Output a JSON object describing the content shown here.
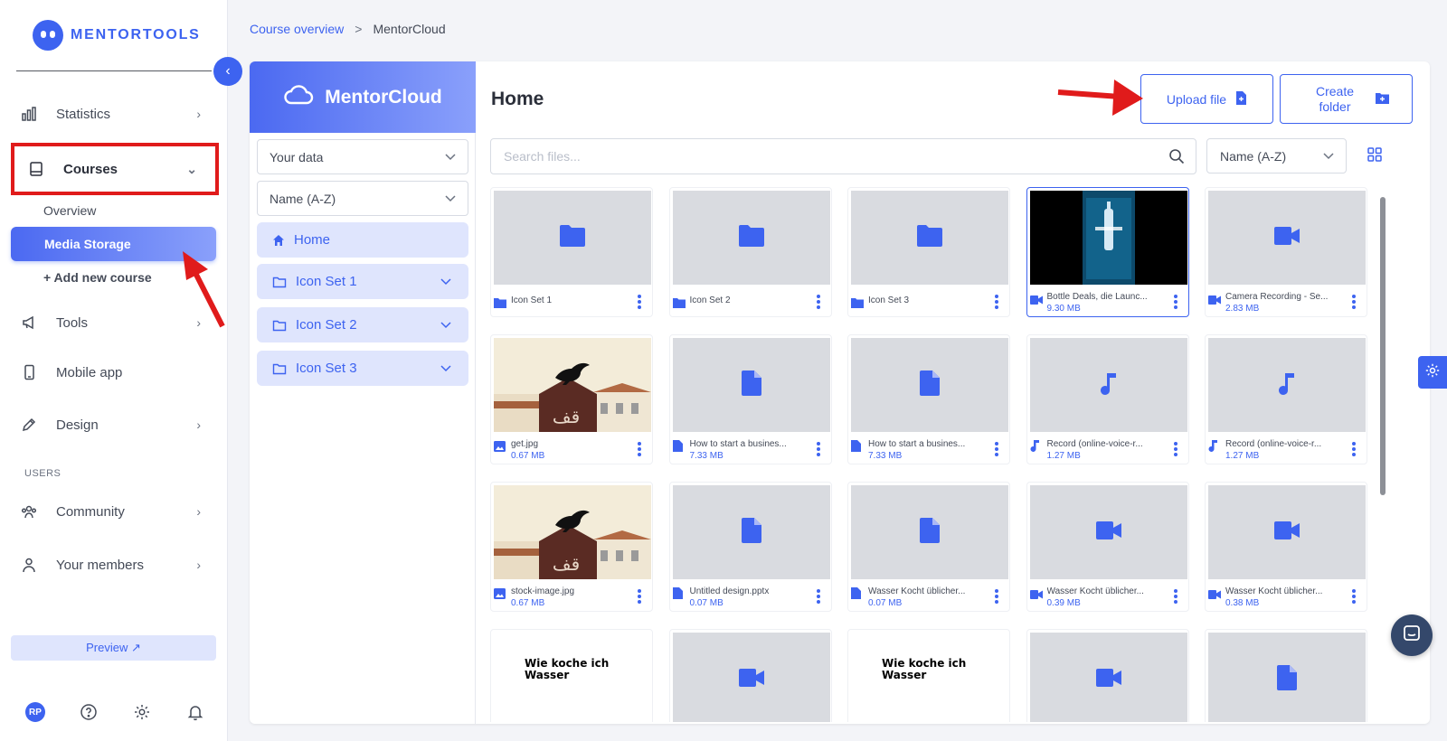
{
  "brand": {
    "name": "MENTORTOOLS"
  },
  "sidebar": {
    "items": [
      {
        "label": "Statistics",
        "icon": "bar-chart-icon"
      },
      {
        "label": "Courses",
        "icon": "book-icon"
      },
      {
        "label": "Tools",
        "icon": "megaphone-icon"
      },
      {
        "label": "Mobile app",
        "icon": "phone-icon"
      },
      {
        "label": "Design",
        "icon": "pencil-icon"
      },
      {
        "label": "Community",
        "icon": "community-icon"
      },
      {
        "label": "Your members",
        "icon": "user-icon"
      }
    ],
    "course_sub": {
      "overview": "Overview",
      "media_storage": "Media Storage",
      "add_course": "+ Add new course"
    },
    "section_users": "USERS",
    "preview_label": "Preview ↗",
    "avatar_initials": "RP"
  },
  "breadcrumb": {
    "link": "Course overview",
    "separator": ">",
    "current": "MentorCloud"
  },
  "cloud_panel": {
    "title": "MentorCloud",
    "filter_select": "Your data",
    "sort_select": "Name (A-Z)",
    "home_label": "Home",
    "folders": [
      "Icon Set 1",
      "Icon Set 2",
      "Icon Set 3"
    ]
  },
  "main": {
    "title": "Home",
    "upload_label": "Upload file",
    "create_folder_label": "Create folder",
    "search_placeholder": "Search files...",
    "sort_value": "Name (A-Z)"
  },
  "files": [
    {
      "name": "Icon Set 1",
      "size": "",
      "type": "folder",
      "thumb": "folder"
    },
    {
      "name": "Icon Set 2",
      "size": "",
      "type": "folder",
      "thumb": "folder"
    },
    {
      "name": "Icon Set 3",
      "size": "",
      "type": "folder",
      "thumb": "folder"
    },
    {
      "name": "Bottle Deals, die Launc...",
      "size": "9.30 MB",
      "type": "video",
      "thumb": "video-frame",
      "selected": true
    },
    {
      "name": "Camera Recording - Se...",
      "size": "2.83 MB",
      "type": "video",
      "thumb": "video"
    },
    {
      "name": "get.jpg",
      "size": "0.67 MB",
      "type": "image",
      "thumb": "photo"
    },
    {
      "name": "How to start a busines...",
      "size": "7.33 MB",
      "type": "doc",
      "thumb": "doc"
    },
    {
      "name": "How to start a busines...",
      "size": "7.33 MB",
      "type": "doc",
      "thumb": "doc"
    },
    {
      "name": "Record (online-voice-r...",
      "size": "1.27 MB",
      "type": "audio",
      "thumb": "audio"
    },
    {
      "name": "Record (online-voice-r...",
      "size": "1.27 MB",
      "type": "audio",
      "thumb": "audio"
    },
    {
      "name": "stock-image.jpg",
      "size": "0.67 MB",
      "type": "image",
      "thumb": "photo"
    },
    {
      "name": "Untitled design.pptx",
      "size": "0.07 MB",
      "type": "doc",
      "thumb": "doc"
    },
    {
      "name": "Wasser Kocht üblicher...",
      "size": "0.07 MB",
      "type": "doc",
      "thumb": "doc"
    },
    {
      "name": "Wasser Kocht üblicher...",
      "size": "0.39 MB",
      "type": "video",
      "thumb": "video"
    },
    {
      "name": "Wasser Kocht üblicher...",
      "size": "0.38 MB",
      "type": "video",
      "thumb": "video"
    },
    {
      "name": "",
      "size": "",
      "type": "image",
      "thumb": "text-image",
      "thumb_text": "Wie koche ich Wasser"
    },
    {
      "name": "",
      "size": "",
      "type": "video",
      "thumb": "video"
    },
    {
      "name": "",
      "size": "",
      "type": "image",
      "thumb": "text-image",
      "thumb_text": "Wie koche ich Wasser"
    },
    {
      "name": "",
      "size": "",
      "type": "video",
      "thumb": "video"
    },
    {
      "name": "",
      "size": "",
      "type": "doc",
      "thumb": "doc"
    }
  ],
  "colors": {
    "accent": "#3d63f0",
    "annotation": "#e01b1b",
    "thumb_bg": "#d9dbe0",
    "chat": "#34486b"
  }
}
